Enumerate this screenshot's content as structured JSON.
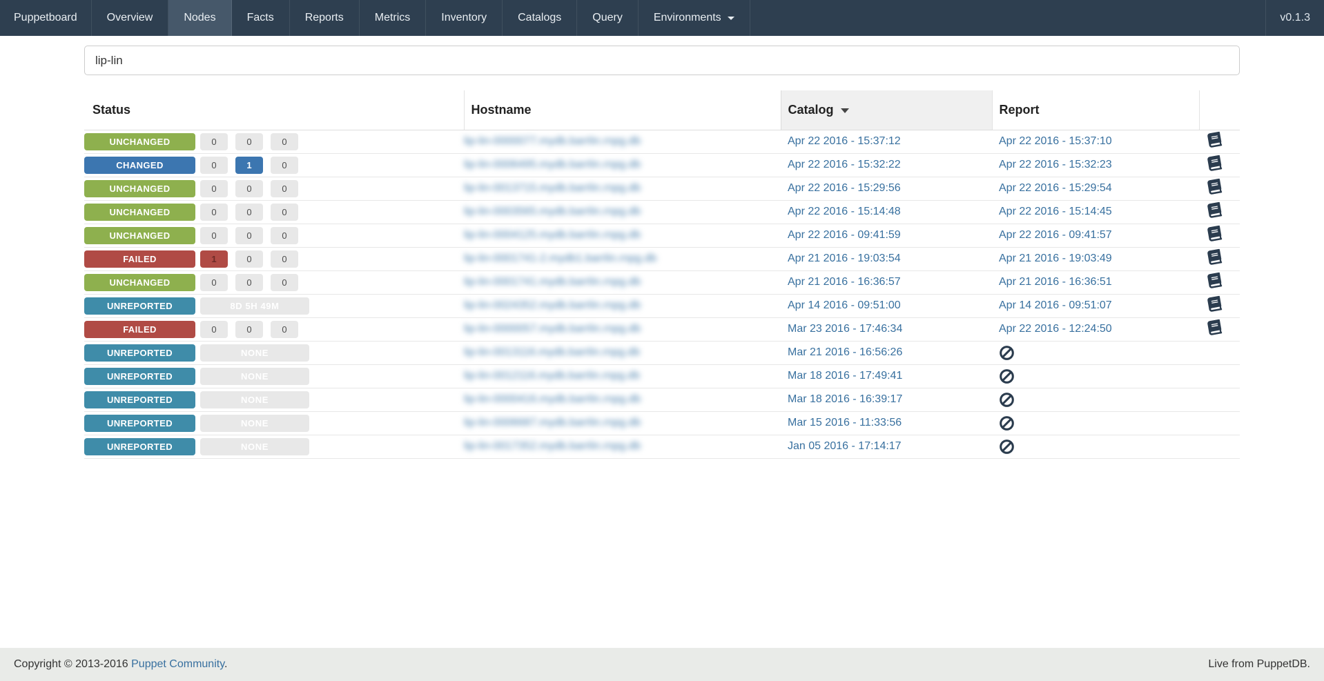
{
  "navbar": {
    "brand": "Puppetboard",
    "items": [
      {
        "label": "Overview"
      },
      {
        "label": "Nodes"
      },
      {
        "label": "Facts"
      },
      {
        "label": "Reports"
      },
      {
        "label": "Metrics"
      },
      {
        "label": "Inventory"
      },
      {
        "label": "Catalogs"
      },
      {
        "label": "Query"
      },
      {
        "label": "Environments"
      }
    ],
    "active_item": "Nodes",
    "version": "v0.1.3"
  },
  "search": {
    "value": "lip-lin"
  },
  "table": {
    "headers": {
      "status": "Status",
      "hostname": "Hostname",
      "catalog": "Catalog",
      "report": "Report"
    },
    "sorted_by": "Catalog",
    "rows": [
      {
        "status": "UNCHANGED",
        "counts": [
          "0",
          "0",
          "0"
        ],
        "hostname": "lip-lin-0000077.mydb.barrlin.rnpg.db",
        "catalog": "Apr 22 2016 - 15:37:12",
        "report": "Apr 22 2016 - 15:37:10"
      },
      {
        "status": "CHANGED",
        "counts": [
          "0",
          "1",
          "0"
        ],
        "hostname": "lip-lin-0006495.mydb.barrlin.rnpg.db",
        "catalog": "Apr 22 2016 - 15:32:22",
        "report": "Apr 22 2016 - 15:32:23"
      },
      {
        "status": "UNCHANGED",
        "counts": [
          "0",
          "0",
          "0"
        ],
        "hostname": "lip-lin-0013715.mydb.barrlin.rnpg.db",
        "catalog": "Apr 22 2016 - 15:29:56",
        "report": "Apr 22 2016 - 15:29:54"
      },
      {
        "status": "UNCHANGED",
        "counts": [
          "0",
          "0",
          "0"
        ],
        "hostname": "lip-lin-0003565.mydb.barrlin.rnpg.db",
        "catalog": "Apr 22 2016 - 15:14:48",
        "report": "Apr 22 2016 - 15:14:45"
      },
      {
        "status": "UNCHANGED",
        "counts": [
          "0",
          "0",
          "0"
        ],
        "hostname": "lip-lin-0004125.mydb.barrlin.rnpg.db",
        "catalog": "Apr 22 2016 - 09:41:59",
        "report": "Apr 22 2016 - 09:41:57"
      },
      {
        "status": "FAILED",
        "counts": [
          "1",
          "0",
          "0"
        ],
        "hostname": "lip-lin-0001741-2.mydb1.barrlin.rnpg.db",
        "catalog": "Apr 21 2016 - 19:03:54",
        "report": "Apr 21 2016 - 19:03:49"
      },
      {
        "status": "UNCHANGED",
        "counts": [
          "0",
          "0",
          "0"
        ],
        "hostname": "lip-lin-0001741.mydb.barrlin.rnpg.db",
        "catalog": "Apr 21 2016 - 16:36:57",
        "report": "Apr 21 2016 - 16:36:51"
      },
      {
        "status": "UNREPORTED",
        "uptime": "8D 5H 49M",
        "hostname": "lip-lin-0024352.mydb.barrlin.rnpg.db",
        "catalog": "Apr 14 2016 - 09:51:00",
        "report": "Apr 14 2016 - 09:51:07"
      },
      {
        "status": "FAILED",
        "counts": [
          "0",
          "0",
          "0"
        ],
        "hostname": "lip-lin-0000057.mydb.barrlin.rnpg.db",
        "catalog": "Mar 23 2016 - 17:46:34",
        "report": "Apr 22 2016 - 12:24:50"
      },
      {
        "status": "UNREPORTED",
        "uptime": "NONE",
        "hostname": "lip-lin-0013116.mydb.barrlin.rnpg.db",
        "catalog": "Mar 21 2016 - 16:56:26"
      },
      {
        "status": "UNREPORTED",
        "uptime": "NONE",
        "hostname": "lip-lin-0012116.mydb.barrlin.rnpg.db",
        "catalog": "Mar 18 2016 - 17:49:41"
      },
      {
        "status": "UNREPORTED",
        "uptime": "NONE",
        "hostname": "lip-lin-0000416.mydb.barrlin.rnpg.db",
        "catalog": "Mar 18 2016 - 16:39:17"
      },
      {
        "status": "UNREPORTED",
        "uptime": "NONE",
        "hostname": "lip-lin-0006687.mydb.barrlin.rnpg.db",
        "catalog": "Mar 15 2016 - 11:33:56"
      },
      {
        "status": "UNREPORTED",
        "uptime": "NONE",
        "hostname": "lip-lin-0017352.mydb.barrlin.rnpg.db",
        "catalog": "Jan 05 2016 - 17:14:17"
      }
    ]
  },
  "footer": {
    "copyright_prefix": "Copyright © 2013-2016",
    "community_link": "Puppet Community",
    "copyright_suffix": ".",
    "live_text": "Live from PuppetDB."
  },
  "colors": {
    "navbar_bg": "#2e3f50",
    "navbar_active_bg": "#46586a",
    "unchanged_green": "#8eb04e",
    "changed_blue": "#3c76b0",
    "failed_red": "#b04b45",
    "unreported_teal": "#3f8ca9",
    "link_blue": "#38709f",
    "icon_navy": "#2b3c4e"
  }
}
